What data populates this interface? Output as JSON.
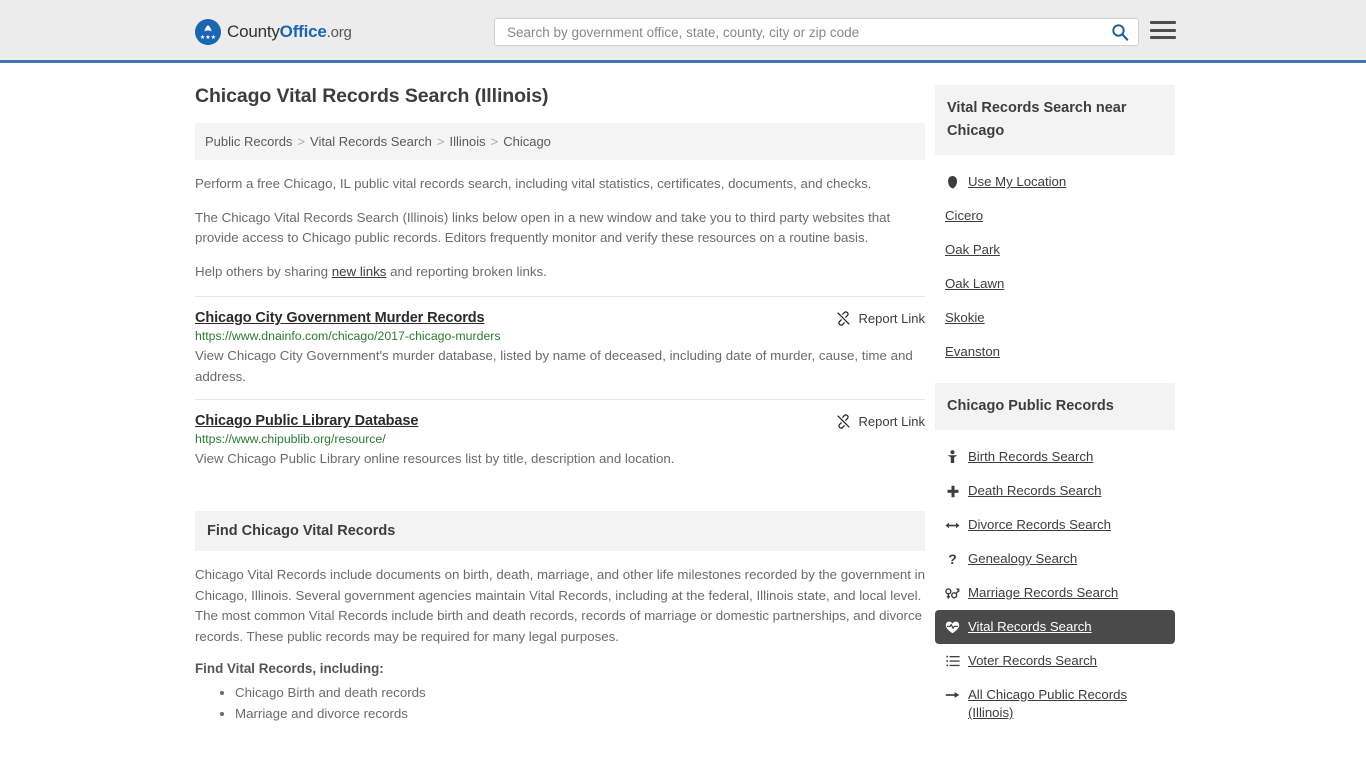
{
  "header": {
    "brand": {
      "part1": "County",
      "part2": "Office",
      "part3": ".org"
    },
    "search": {
      "placeholder": "Search by government office, state, county, city or zip code",
      "value": ""
    },
    "menu_label": "menu"
  },
  "page": {
    "title": "Chicago Vital Records Search (Illinois)"
  },
  "breadcrumb": {
    "items": [
      {
        "label": "Public Records"
      },
      {
        "label": "Vital Records Search"
      },
      {
        "label": "Illinois"
      },
      {
        "label": "Chicago"
      }
    ],
    "separator": ">"
  },
  "intro": {
    "p1": "Perform a free Chicago, IL public vital records search, including vital statistics, certificates, documents, and checks.",
    "p2": "The Chicago Vital Records Search (Illinois) links below open in a new window and take you to third party websites that provide access to Chicago public records. Editors frequently monitor and verify these resources on a routine basis.",
    "p3_before": "Help others by sharing ",
    "p3_link": "new links",
    "p3_after": " and reporting broken links."
  },
  "results": {
    "report_label": "Report Link",
    "items": [
      {
        "title": "Chicago City Government Murder Records",
        "url": "https://www.dnainfo.com/chicago/2017-chicago-murders",
        "desc": "View Chicago City Government's murder database, listed by name of deceased, including date of murder, cause, time and address."
      },
      {
        "title": "Chicago Public Library Database",
        "url": "https://www.chipublib.org/resource/",
        "desc": "View Chicago Public Library online resources list by title, description and location."
      }
    ]
  },
  "find_section": {
    "heading": "Find Chicago Vital Records",
    "body": "Chicago Vital Records include documents on birth, death, marriage, and other life milestones recorded by the government in Chicago, Illinois. Several government agencies maintain Vital Records, including at the federal, Illinois state, and local level. The most common Vital Records include birth and death records, records of marriage or domestic partnerships, and divorce records. These public records may be required for many legal purposes.",
    "list_heading": "Find Vital Records, including:",
    "list_items": [
      "Chicago Birth and death records",
      "Marriage and divorce records"
    ]
  },
  "sidebar": {
    "nearby": {
      "heading": "Vital Records Search near Chicago",
      "items": [
        {
          "label": "Use My Location",
          "icon": "map-pin-icon"
        },
        {
          "label": "Cicero",
          "icon": ""
        },
        {
          "label": "Oak Park",
          "icon": ""
        },
        {
          "label": "Oak Lawn",
          "icon": ""
        },
        {
          "label": "Skokie",
          "icon": ""
        },
        {
          "label": "Evanston",
          "icon": ""
        }
      ]
    },
    "public_records": {
      "heading": "Chicago Public Records",
      "items": [
        {
          "label": "Birth Records Search",
          "icon": "baby-icon",
          "glyph": "Ŧ",
          "active": false
        },
        {
          "label": "Death Records Search",
          "icon": "cross-icon",
          "glyph": "✚",
          "active": false
        },
        {
          "label": "Divorce Records Search",
          "icon": "arrows-left-right-icon",
          "glyph": "↔",
          "active": false
        },
        {
          "label": "Genealogy Search",
          "icon": "question-mark-icon",
          "glyph": "?",
          "active": false
        },
        {
          "label": "Marriage Records Search",
          "icon": "venus-mars-icon",
          "glyph": "⚥",
          "active": false
        },
        {
          "label": "Vital Records Search",
          "icon": "heart-pulse-icon",
          "glyph": "❤",
          "active": true
        },
        {
          "label": "Voter Records Search",
          "icon": "list-ordered-icon",
          "glyph": "≣",
          "active": false
        },
        {
          "label": "All Chicago Public Records (Illinois)",
          "icon": "arrow-right-icon",
          "glyph": "→",
          "active": false
        }
      ]
    }
  },
  "colors": {
    "header_bg": "#ececec",
    "header_border": "#3a78ad",
    "brand_blue": "#1a66b0",
    "url_green": "#2d7b33",
    "panel_gray": "#f3f3f3",
    "active_bg": "#4a4a4a"
  }
}
